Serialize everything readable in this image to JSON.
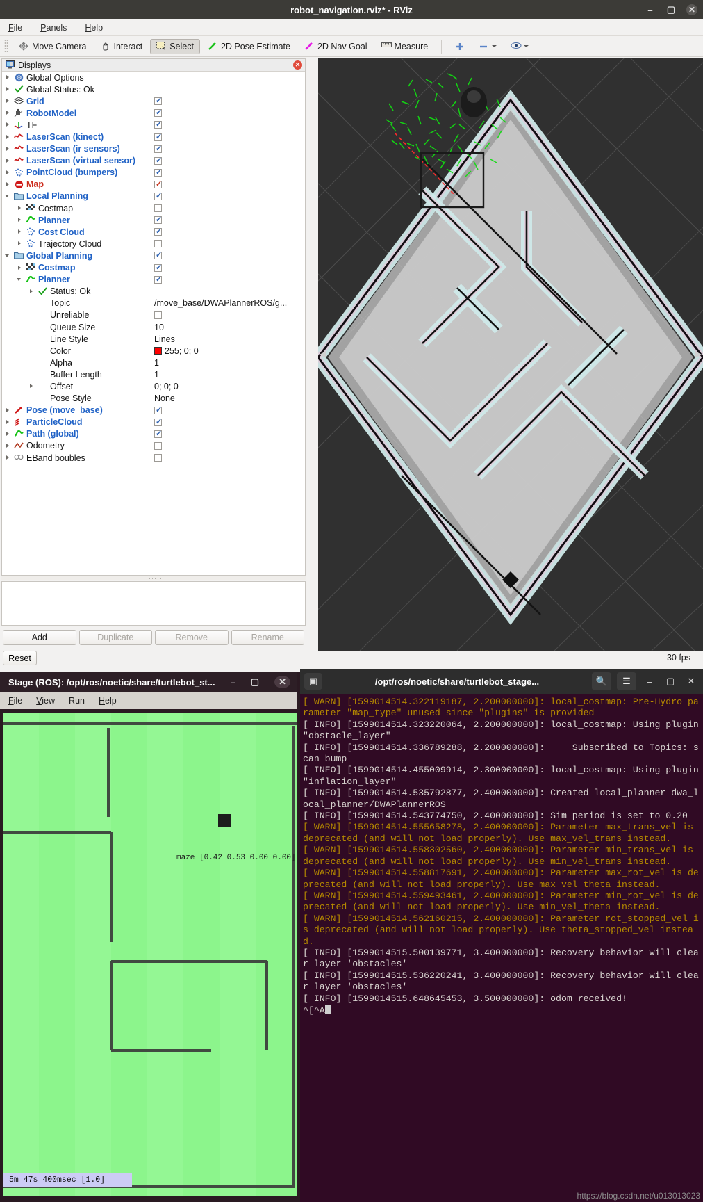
{
  "rviz": {
    "title": "robot_navigation.rviz* - RViz",
    "window_buttons": [
      "minimize-icon",
      "maximize-icon",
      "close-icon"
    ],
    "menu": [
      "File",
      "Panels",
      "Help"
    ],
    "toolbar": [
      {
        "label": "Move Camera",
        "icon": "move-camera-icon",
        "active": false
      },
      {
        "label": "Interact",
        "icon": "hand-icon",
        "active": false
      },
      {
        "label": "Select",
        "icon": "select-rect-icon",
        "active": true
      },
      {
        "label": "2D Pose Estimate",
        "icon": "green-arrow-icon",
        "active": false
      },
      {
        "label": "2D Nav Goal",
        "icon": "magenta-arrow-icon",
        "active": false
      },
      {
        "label": "Measure",
        "icon": "ruler-icon",
        "active": false
      }
    ],
    "toolbar_right": [
      "plus-icon",
      "minus-icon",
      "eye-icon"
    ],
    "displays_panel": {
      "title": "Displays",
      "rows": [
        {
          "indent": 0,
          "arrow": "right",
          "icon": "gear-icon",
          "label": "Global Options",
          "style": "plain",
          "value": ""
        },
        {
          "indent": 0,
          "arrow": "right",
          "icon": "check-icon",
          "label": "Global Status: Ok",
          "style": "plain",
          "value": ""
        },
        {
          "indent": 0,
          "arrow": "right",
          "icon": "grid-icon",
          "label": "Grid",
          "style": "blue",
          "value": "checkbox-on"
        },
        {
          "indent": 0,
          "arrow": "right",
          "icon": "robot-icon",
          "label": "RobotModel",
          "style": "blue",
          "value": "checkbox-on"
        },
        {
          "indent": 0,
          "arrow": "right",
          "icon": "tf-axes-icon",
          "label": "TF",
          "style": "plain",
          "value": "checkbox-on"
        },
        {
          "indent": 0,
          "arrow": "right",
          "icon": "laserscan-icon",
          "label": "LaserScan (kinect)",
          "style": "blue",
          "value": "checkbox-on"
        },
        {
          "indent": 0,
          "arrow": "right",
          "icon": "laserscan-icon",
          "label": "LaserScan (ir sensors)",
          "style": "blue",
          "value": "checkbox-on"
        },
        {
          "indent": 0,
          "arrow": "right",
          "icon": "laserscan-icon",
          "label": "LaserScan (virtual sensor)",
          "style": "blue",
          "value": "checkbox-on"
        },
        {
          "indent": 0,
          "arrow": "right",
          "icon": "pointcloud-icon",
          "label": "PointCloud (bumpers)",
          "style": "blue",
          "value": "checkbox-on"
        },
        {
          "indent": 0,
          "arrow": "right",
          "icon": "map-icon",
          "label": "Map",
          "style": "red",
          "value": "checkbox-on-red"
        },
        {
          "indent": 0,
          "arrow": "down",
          "icon": "folder-icon",
          "label": "Local Planning",
          "style": "blue",
          "value": "checkbox-on"
        },
        {
          "indent": 1,
          "arrow": "right",
          "icon": "costmap-icon",
          "label": "Costmap",
          "style": "plain",
          "value": "checkbox-off"
        },
        {
          "indent": 1,
          "arrow": "right",
          "icon": "path-icon",
          "label": "Planner",
          "style": "blue",
          "value": "checkbox-on"
        },
        {
          "indent": 1,
          "arrow": "right",
          "icon": "pointcloud-icon",
          "label": "Cost Cloud",
          "style": "blue",
          "value": "checkbox-on"
        },
        {
          "indent": 1,
          "arrow": "right",
          "icon": "pointcloud-icon",
          "label": "Trajectory Cloud",
          "style": "plain",
          "value": "checkbox-off"
        },
        {
          "indent": 0,
          "arrow": "down",
          "icon": "folder-icon",
          "label": "Global Planning",
          "style": "blue",
          "value": "checkbox-on"
        },
        {
          "indent": 1,
          "arrow": "right",
          "icon": "costmap-icon",
          "label": "Costmap",
          "style": "blue",
          "value": "checkbox-on"
        },
        {
          "indent": 1,
          "arrow": "down",
          "icon": "path-icon",
          "label": "Planner",
          "style": "blue",
          "value": "checkbox-on"
        },
        {
          "indent": 2,
          "arrow": "right",
          "icon": "check-icon",
          "label": "Status: Ok",
          "style": "plain",
          "value": ""
        },
        {
          "indent": 2,
          "arrow": "none",
          "icon": "none",
          "label": "Topic",
          "style": "plain",
          "value": "/move_base/DWAPlannerROS/g..."
        },
        {
          "indent": 2,
          "arrow": "none",
          "icon": "none",
          "label": "Unreliable",
          "style": "plain",
          "value": "checkbox-off"
        },
        {
          "indent": 2,
          "arrow": "none",
          "icon": "none",
          "label": "Queue Size",
          "style": "plain",
          "value": "10"
        },
        {
          "indent": 2,
          "arrow": "none",
          "icon": "none",
          "label": "Line Style",
          "style": "plain",
          "value": "Lines"
        },
        {
          "indent": 2,
          "arrow": "none",
          "icon": "none",
          "label": "Color",
          "style": "plain",
          "value": "swatch:255; 0; 0"
        },
        {
          "indent": 2,
          "arrow": "none",
          "icon": "none",
          "label": "Alpha",
          "style": "plain",
          "value": "1"
        },
        {
          "indent": 2,
          "arrow": "none",
          "icon": "none",
          "label": "Buffer Length",
          "style": "plain",
          "value": "1"
        },
        {
          "indent": 2,
          "arrow": "right",
          "icon": "none",
          "label": "Offset",
          "style": "plain",
          "value": "0; 0; 0"
        },
        {
          "indent": 2,
          "arrow": "none",
          "icon": "none",
          "label": "Pose Style",
          "style": "plain",
          "value": "None"
        },
        {
          "indent": 0,
          "arrow": "right",
          "icon": "pose-icon",
          "label": "Pose (move_base)",
          "style": "blue",
          "value": "checkbox-on"
        },
        {
          "indent": 0,
          "arrow": "right",
          "icon": "particlecloud-icon",
          "label": "ParticleCloud",
          "style": "blue",
          "value": "checkbox-on"
        },
        {
          "indent": 0,
          "arrow": "right",
          "icon": "path-icon",
          "label": "Path (global)",
          "style": "blue",
          "value": "checkbox-on"
        },
        {
          "indent": 0,
          "arrow": "right",
          "icon": "odometry-icon",
          "label": "Odometry",
          "style": "plain",
          "value": "checkbox-off"
        },
        {
          "indent": 0,
          "arrow": "right",
          "icon": "eband-icon",
          "label": "EBand boubles",
          "style": "plain",
          "value": "checkbox-off"
        }
      ],
      "buttons": [
        {
          "label": "Add",
          "enabled": true
        },
        {
          "label": "Duplicate",
          "enabled": false
        },
        {
          "label": "Remove",
          "enabled": false
        },
        {
          "label": "Rename",
          "enabled": false
        }
      ],
      "reset_button": "Reset"
    },
    "fps": "30 fps"
  },
  "stage": {
    "title": "Stage (ROS): /opt/ros/noetic/share/turtlebot_st...",
    "window_buttons": [
      "minimize-icon",
      "maximize-icon",
      "close-icon"
    ],
    "menu": [
      "File",
      "View",
      "Run",
      "Help"
    ],
    "world_label": "maze [0.42 0.53 0.00 0.00]",
    "status": "5m 47s 400msec [1.0]"
  },
  "terminal": {
    "title": "/opt/ros/noetic/share/turtlebot_stage...",
    "new_tab_icon": "new-tab-icon",
    "search_icon": "search-icon",
    "menu_icon": "hamburger-menu-icon",
    "window_buttons": [
      "minimize-icon",
      "maximize-icon",
      "close-icon"
    ],
    "lines": [
      {
        "level": "warn",
        "text": "[ WARN] [1599014514.322119187, 2.200000000]: local_costmap: Pre-Hydro parameter \"map_type\" unused since \"plugins\" is provided"
      },
      {
        "level": "info",
        "text": "[ INFO] [1599014514.323220064, 2.200000000]: local_costmap: Using plugin \"obstacle_layer\""
      },
      {
        "level": "info",
        "text": "[ INFO] [1599014514.336789288, 2.200000000]:     Subscribed to Topics: scan bump"
      },
      {
        "level": "info",
        "text": "[ INFO] [1599014514.455009914, 2.300000000]: local_costmap: Using plugin \"inflation_layer\""
      },
      {
        "level": "info",
        "text": "[ INFO] [1599014514.535792877, 2.400000000]: Created local_planner dwa_local_planner/DWAPlannerROS"
      },
      {
        "level": "info",
        "text": "[ INFO] [1599014514.543774750, 2.400000000]: Sim period is set to 0.20"
      },
      {
        "level": "warn",
        "text": "[ WARN] [1599014514.555658278, 2.400000000]: Parameter max_trans_vel is deprecated (and will not load properly). Use max_vel_trans instead."
      },
      {
        "level": "warn",
        "text": "[ WARN] [1599014514.558302560, 2.400000000]: Parameter min_trans_vel is deprecated (and will not load properly). Use min_vel_trans instead."
      },
      {
        "level": "warn",
        "text": "[ WARN] [1599014514.558817691, 2.400000000]: Parameter max_rot_vel is deprecated (and will not load properly). Use max_vel_theta instead."
      },
      {
        "level": "warn",
        "text": "[ WARN] [1599014514.559493461, 2.400000000]: Parameter min_rot_vel is deprecated (and will not load properly). Use min_vel_theta instead."
      },
      {
        "level": "warn",
        "text": "[ WARN] [1599014514.562160215, 2.400000000]: Parameter rot_stopped_vel is deprecated (and will not load properly). Use theta_stopped_vel instead."
      },
      {
        "level": "info",
        "text": "[ INFO] [1599014515.500139771, 3.400000000]: Recovery behavior will clear layer 'obstacles'"
      },
      {
        "level": "info",
        "text": "[ INFO] [1599014515.536220241, 3.400000000]: Recovery behavior will clear layer 'obstacles'"
      },
      {
        "level": "info",
        "text": "[ INFO] [1599014515.648645453, 3.500000000]: odom received!"
      }
    ],
    "prompt": "^[^A"
  },
  "watermark": "https://blog.csdn.net/u013013023",
  "colors": {
    "accent_blue": "#2062c6",
    "accent_red": "#cc2b1c",
    "warn_yellow": "#b58900",
    "terminal_bg": "#300a24",
    "stage_green": "#8cf58c"
  }
}
